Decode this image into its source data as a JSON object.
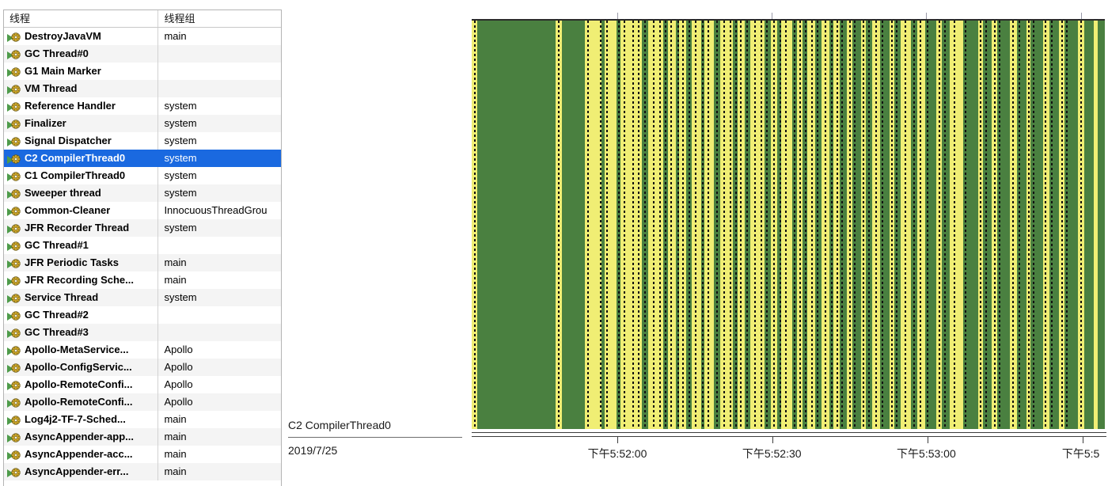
{
  "table": {
    "columns": [
      "线程",
      "线程组"
    ],
    "selected_index": 7,
    "rows": [
      {
        "thread": "DestroyJavaVM",
        "group": "main"
      },
      {
        "thread": "GC Thread#0",
        "group": ""
      },
      {
        "thread": "G1 Main Marker",
        "group": ""
      },
      {
        "thread": "VM Thread",
        "group": ""
      },
      {
        "thread": "Reference Handler",
        "group": "system"
      },
      {
        "thread": "Finalizer",
        "group": "system"
      },
      {
        "thread": "Signal Dispatcher",
        "group": "system"
      },
      {
        "thread": "C2 CompilerThread0",
        "group": "system"
      },
      {
        "thread": "C1 CompilerThread0",
        "group": "system"
      },
      {
        "thread": "Sweeper thread",
        "group": "system"
      },
      {
        "thread": "Common-Cleaner",
        "group": "InnocuousThreadGrou"
      },
      {
        "thread": "JFR Recorder Thread",
        "group": "system"
      },
      {
        "thread": "GC Thread#1",
        "group": ""
      },
      {
        "thread": "JFR Periodic Tasks",
        "group": "main"
      },
      {
        "thread": "JFR Recording Sche...",
        "group": "main"
      },
      {
        "thread": "Service Thread",
        "group": "system"
      },
      {
        "thread": "GC Thread#2",
        "group": ""
      },
      {
        "thread": "GC Thread#3",
        "group": ""
      },
      {
        "thread": "Apollo-MetaService...",
        "group": "Apollo"
      },
      {
        "thread": "Apollo-ConfigServic...",
        "group": "Apollo"
      },
      {
        "thread": "Apollo-RemoteConfi...",
        "group": "Apollo"
      },
      {
        "thread": "Apollo-RemoteConfi...",
        "group": "Apollo"
      },
      {
        "thread": "Log4j2-TF-7-Sched...",
        "group": "main"
      },
      {
        "thread": "AsyncAppender-app...",
        "group": "main"
      },
      {
        "thread": "AsyncAppender-acc...",
        "group": "main"
      },
      {
        "thread": "AsyncAppender-err...",
        "group": "main"
      }
    ]
  },
  "legend": {
    "thread_label": "C2 CompilerThread0",
    "date": "2019/7/25"
  },
  "colors": {
    "running": "#4a8040",
    "waiting": "#f0ee74",
    "selection": "#1a69e0",
    "axis": "#3c3c3c"
  },
  "chart_data": {
    "type": "timeline",
    "title": "C2 CompilerThread0",
    "date": "2019/7/25",
    "xlabel": "",
    "ylabel": "",
    "grid": false,
    "legend_position": "left",
    "axis_ticks": [
      {
        "position_pct": 23.0,
        "label": "下午5:52:00"
      },
      {
        "position_pct": 47.4,
        "label": "下午5:52:30"
      },
      {
        "position_pct": 71.8,
        "label": "下午5:53:00"
      },
      {
        "position_pct": 96.2,
        "label": "下午5:5"
      }
    ],
    "states": [
      {
        "name": "running",
        "color": "#4a8040"
      },
      {
        "name": "waiting",
        "color": "#f0ee74"
      }
    ],
    "segments": [
      {
        "start_pct": 0.0,
        "width_pct": 0.9,
        "state": "waiting"
      },
      {
        "start_pct": 0.9,
        "width_pct": 12.4,
        "state": "running"
      },
      {
        "start_pct": 13.3,
        "width_pct": 1.0,
        "state": "waiting"
      },
      {
        "start_pct": 14.3,
        "width_pct": 3.6,
        "state": "running"
      },
      {
        "start_pct": 17.9,
        "width_pct": 2.6,
        "state": "waiting"
      },
      {
        "start_pct": 20.5,
        "width_pct": 0.5,
        "state": "running"
      },
      {
        "start_pct": 21.0,
        "width_pct": 1.9,
        "state": "waiting"
      },
      {
        "start_pct": 22.9,
        "width_pct": 0.6,
        "state": "running"
      },
      {
        "start_pct": 23.5,
        "width_pct": 3.4,
        "state": "waiting"
      },
      {
        "start_pct": 26.9,
        "width_pct": 1.0,
        "state": "running"
      },
      {
        "start_pct": 27.9,
        "width_pct": 2.3,
        "state": "waiting"
      },
      {
        "start_pct": 30.2,
        "width_pct": 0.8,
        "state": "running"
      },
      {
        "start_pct": 31.0,
        "width_pct": 1.3,
        "state": "waiting"
      },
      {
        "start_pct": 32.3,
        "width_pct": 0.5,
        "state": "running"
      },
      {
        "start_pct": 32.8,
        "width_pct": 1.1,
        "state": "waiting"
      },
      {
        "start_pct": 33.9,
        "width_pct": 0.9,
        "state": "running"
      },
      {
        "start_pct": 34.8,
        "width_pct": 1.4,
        "state": "waiting"
      },
      {
        "start_pct": 36.2,
        "width_pct": 0.6,
        "state": "running"
      },
      {
        "start_pct": 36.8,
        "width_pct": 1.5,
        "state": "waiting"
      },
      {
        "start_pct": 38.3,
        "width_pct": 1.0,
        "state": "running"
      },
      {
        "start_pct": 39.3,
        "width_pct": 2.0,
        "state": "waiting"
      },
      {
        "start_pct": 41.3,
        "width_pct": 0.7,
        "state": "running"
      },
      {
        "start_pct": 42.0,
        "width_pct": 1.1,
        "state": "waiting"
      },
      {
        "start_pct": 43.1,
        "width_pct": 0.9,
        "state": "running"
      },
      {
        "start_pct": 44.0,
        "width_pct": 2.2,
        "state": "waiting"
      },
      {
        "start_pct": 46.2,
        "width_pct": 1.1,
        "state": "running"
      },
      {
        "start_pct": 47.3,
        "width_pct": 1.0,
        "state": "waiting"
      },
      {
        "start_pct": 48.3,
        "width_pct": 0.6,
        "state": "running"
      },
      {
        "start_pct": 48.9,
        "width_pct": 1.7,
        "state": "waiting"
      },
      {
        "start_pct": 50.6,
        "width_pct": 0.8,
        "state": "running"
      },
      {
        "start_pct": 51.4,
        "width_pct": 0.9,
        "state": "waiting"
      },
      {
        "start_pct": 52.3,
        "width_pct": 0.7,
        "state": "running"
      },
      {
        "start_pct": 53.0,
        "width_pct": 1.2,
        "state": "waiting"
      },
      {
        "start_pct": 54.2,
        "width_pct": 1.0,
        "state": "running"
      },
      {
        "start_pct": 55.2,
        "width_pct": 1.3,
        "state": "waiting"
      },
      {
        "start_pct": 56.5,
        "width_pct": 0.6,
        "state": "running"
      },
      {
        "start_pct": 57.1,
        "width_pct": 1.0,
        "state": "waiting"
      },
      {
        "start_pct": 58.1,
        "width_pct": 1.1,
        "state": "running"
      },
      {
        "start_pct": 59.2,
        "width_pct": 0.9,
        "state": "waiting"
      },
      {
        "start_pct": 60.1,
        "width_pct": 1.4,
        "state": "running"
      },
      {
        "start_pct": 61.5,
        "width_pct": 0.8,
        "state": "waiting"
      },
      {
        "start_pct": 62.3,
        "width_pct": 0.9,
        "state": "running"
      },
      {
        "start_pct": 63.2,
        "width_pct": 1.3,
        "state": "waiting"
      },
      {
        "start_pct": 64.5,
        "width_pct": 1.5,
        "state": "running"
      },
      {
        "start_pct": 66.0,
        "width_pct": 0.7,
        "state": "waiting"
      },
      {
        "start_pct": 66.7,
        "width_pct": 1.1,
        "state": "running"
      },
      {
        "start_pct": 67.8,
        "width_pct": 1.6,
        "state": "waiting"
      },
      {
        "start_pct": 69.4,
        "width_pct": 1.0,
        "state": "running"
      },
      {
        "start_pct": 70.4,
        "width_pct": 1.2,
        "state": "waiting"
      },
      {
        "start_pct": 71.6,
        "width_pct": 1.8,
        "state": "running"
      },
      {
        "start_pct": 73.4,
        "width_pct": 0.9,
        "state": "waiting"
      },
      {
        "start_pct": 74.3,
        "width_pct": 1.2,
        "state": "running"
      },
      {
        "start_pct": 75.5,
        "width_pct": 2.1,
        "state": "waiting"
      },
      {
        "start_pct": 77.6,
        "width_pct": 2.4,
        "state": "running"
      },
      {
        "start_pct": 80.0,
        "width_pct": 0.8,
        "state": "waiting"
      },
      {
        "start_pct": 80.8,
        "width_pct": 1.3,
        "state": "running"
      },
      {
        "start_pct": 82.1,
        "width_pct": 0.9,
        "state": "waiting"
      },
      {
        "start_pct": 83.0,
        "width_pct": 2.0,
        "state": "running"
      },
      {
        "start_pct": 85.0,
        "width_pct": 1.1,
        "state": "waiting"
      },
      {
        "start_pct": 86.1,
        "width_pct": 1.5,
        "state": "running"
      },
      {
        "start_pct": 87.6,
        "width_pct": 0.7,
        "state": "waiting"
      },
      {
        "start_pct": 88.3,
        "width_pct": 1.9,
        "state": "running"
      },
      {
        "start_pct": 90.2,
        "width_pct": 1.0,
        "state": "waiting"
      },
      {
        "start_pct": 91.2,
        "width_pct": 1.6,
        "state": "running"
      },
      {
        "start_pct": 92.8,
        "width_pct": 0.8,
        "state": "waiting"
      },
      {
        "start_pct": 93.6,
        "width_pct": 2.2,
        "state": "running"
      },
      {
        "start_pct": 95.8,
        "width_pct": 0.9,
        "state": "waiting"
      },
      {
        "start_pct": 96.7,
        "width_pct": 1.5,
        "state": "running"
      },
      {
        "start_pct": 98.2,
        "width_pct": 0.7,
        "state": "waiting"
      },
      {
        "start_pct": 98.9,
        "width_pct": 1.1,
        "state": "running"
      }
    ],
    "event_markers_pct": [
      0.4,
      13.6,
      18.2,
      20.2,
      21.3,
      23.1,
      24.0,
      25.4,
      26.2,
      27.2,
      28.6,
      29.6,
      30.5,
      31.4,
      32.5,
      33.2,
      34.2,
      35.2,
      36.4,
      37.3,
      38.6,
      39.8,
      40.8,
      41.6,
      42.4,
      43.4,
      44.6,
      45.6,
      46.5,
      47.6,
      48.6,
      49.5,
      50.9,
      51.8,
      52.6,
      53.6,
      54.5,
      55.8,
      56.8,
      57.6,
      58.4,
      59.6,
      60.4,
      61.8,
      62.6,
      63.8,
      64.8,
      66.3,
      67.0,
      68.4,
      69.7,
      70.8,
      71.9,
      73.8,
      74.6,
      76.1,
      77.9,
      80.3,
      81.1,
      82.5,
      83.3,
      85.4,
      86.4,
      87.9,
      88.6,
      90.5,
      91.5,
      93.1,
      93.9,
      96.1
    ],
    "top_ticks_pct": [
      23.0,
      47.4,
      71.8,
      96.2
    ]
  }
}
